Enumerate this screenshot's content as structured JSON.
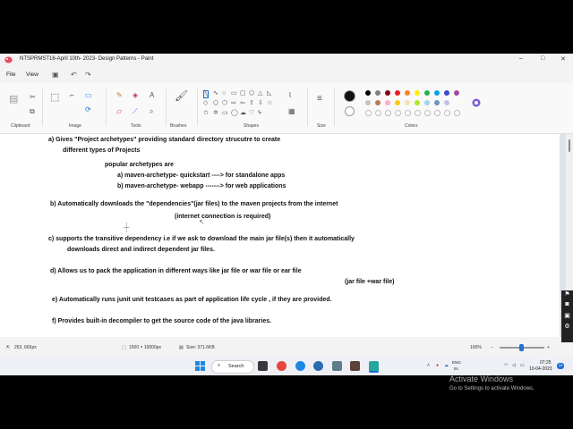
{
  "window": {
    "title": "NTSPRMST16-April 10th- 2023- Design Patterns - Paint",
    "minimize": "–",
    "maximize": "□",
    "close": "✕"
  },
  "menu": {
    "file": "File",
    "view": "View"
  },
  "ribbon": {
    "groups": {
      "clipboard": "Clipboard",
      "image": "Image",
      "tools": "Tools",
      "brushes": "Brushes",
      "shapes": "Shapes",
      "size": "Size",
      "colors": "Colors"
    },
    "palette": [
      "#000000",
      "#7f7f7f",
      "#880015",
      "#ed1c24",
      "#ff7f27",
      "#fff200",
      "#22b14c",
      "#00a2e8",
      "#3f48cc",
      "#a349a4"
    ],
    "palette2": [
      "#c3c3c3",
      "#b97a57",
      "#ffaec9",
      "#ffc90e",
      "#efe4b0",
      "#b5e61d",
      "#99d9ea",
      "#7092be",
      "#c8bfe7"
    ],
    "primary_color": "#111111",
    "secondary_color": "#ffffff"
  },
  "document": {
    "lines": [
      "a)  Gives  \"Project archetypes\"  providing  standard directory strucutre  to create",
      "different types of  Projects",
      "popular  archetypes are",
      "a) maven-archetype- quickstart ---->  for standalone apps",
      "b) maven-archetype- webapp  ------->  for web applications",
      "b) Automatically downloads the  \"dependencies\"(jar files)  to the maven projects from the internet",
      "(internet connection is required)",
      "c)  supports  the transitive dependency i.e if we ask to download the main jar file(s) then it automatically",
      "downloads   direct and indirect dependent jar files.",
      "d) Allows us to pack the application in different ways  like jar file or war file  or ear file",
      "(jar file +war file)",
      "e) Automatically runs  junit  unit testcases as part of application life cycle  , if they are provided.",
      "f)  Provides  built-in decompiler  to  get the source code of the java libraries."
    ]
  },
  "watermark": {
    "title": "Activate Windows",
    "subtitle": "Go to Settings to activate Windows."
  },
  "status": {
    "cursor": "263, 665px",
    "canvas_size": "1500 × 10000px",
    "file_size": "Size: 371.6KB",
    "zoom": "100%"
  },
  "taskbar": {
    "search": "Search",
    "lang": "ENG",
    "region": "IN",
    "time": "07:25",
    "date": "10-04-2023",
    "badge": "10"
  }
}
